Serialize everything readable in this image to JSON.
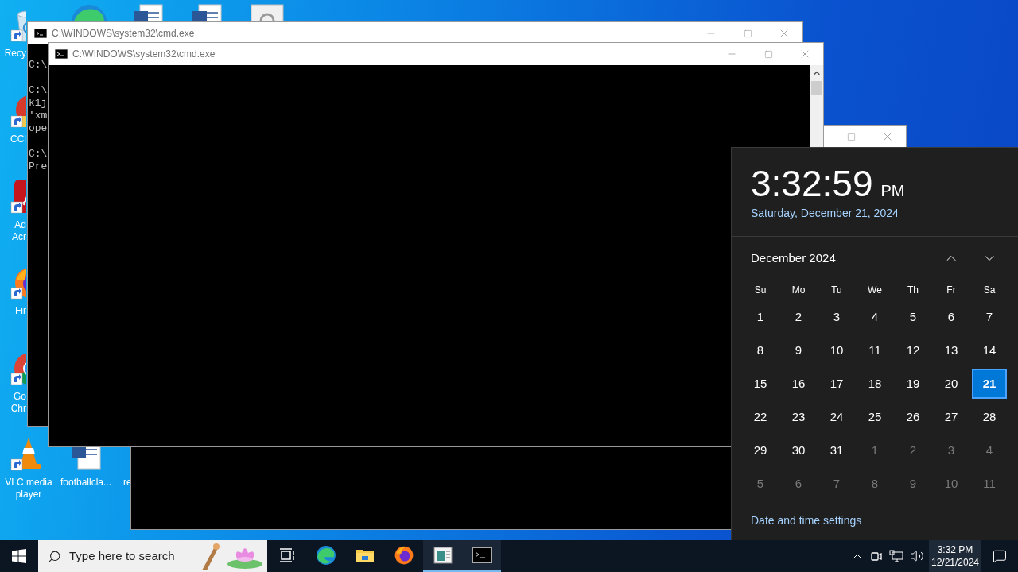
{
  "desktop": {
    "top_icons": [
      {
        "kind": "edge"
      },
      {
        "kind": "word"
      },
      {
        "kind": "word"
      },
      {
        "kind": "settings"
      }
    ],
    "icons": [
      {
        "kind": "recycle",
        "lines": [
          "Recy"
        ]
      },
      {
        "kind": "ccleaner",
        "lines": [
          "CCl"
        ]
      },
      {
        "kind": "acrobat",
        "lines": [
          "Ad",
          "Acr"
        ]
      },
      {
        "kind": "firefox",
        "lines": [
          "Fir"
        ]
      },
      {
        "kind": "chrome",
        "lines": [
          "Go",
          "Chr"
        ]
      },
      {
        "kind": "vlc",
        "lines": [
          "VLC media",
          "player"
        ]
      },
      {
        "kind": "word",
        "lines": [
          "footballcla..."
        ]
      },
      {
        "kind": "none",
        "lines": [
          "re"
        ]
      }
    ]
  },
  "windows": [
    {
      "title": "C:\\WINDOWS\\system32\\cmd.exe",
      "console_blocks": [
        [
          "C:\\"
        ],
        [
          "C:\\",
          "k1j",
          "'xm",
          "ope"
        ],
        [
          "C:\\",
          "Pre"
        ]
      ]
    },
    {
      "title": "C:\\WINDOWS\\system32\\cmd.exe"
    }
  ],
  "clock_flyout": {
    "time": "3:32:59",
    "ampm": "PM",
    "date": "Saturday, December 21, 2024",
    "month": "December 2024",
    "weekdays": [
      "Su",
      "Mo",
      "Tu",
      "We",
      "Th",
      "Fr",
      "Sa"
    ],
    "weeks": [
      [
        {
          "day": "1",
          "in_month": true,
          "selected": false
        },
        {
          "day": "2",
          "in_month": true,
          "selected": false
        },
        {
          "day": "3",
          "in_month": true,
          "selected": false
        },
        {
          "day": "4",
          "in_month": true,
          "selected": false
        },
        {
          "day": "5",
          "in_month": true,
          "selected": false
        },
        {
          "day": "6",
          "in_month": true,
          "selected": false
        },
        {
          "day": "7",
          "in_month": true,
          "selected": false
        }
      ],
      [
        {
          "day": "8",
          "in_month": true,
          "selected": false
        },
        {
          "day": "9",
          "in_month": true,
          "selected": false
        },
        {
          "day": "10",
          "in_month": true,
          "selected": false
        },
        {
          "day": "11",
          "in_month": true,
          "selected": false
        },
        {
          "day": "12",
          "in_month": true,
          "selected": false
        },
        {
          "day": "13",
          "in_month": true,
          "selected": false
        },
        {
          "day": "14",
          "in_month": true,
          "selected": false
        }
      ],
      [
        {
          "day": "15",
          "in_month": true,
          "selected": false
        },
        {
          "day": "16",
          "in_month": true,
          "selected": false
        },
        {
          "day": "17",
          "in_month": true,
          "selected": false
        },
        {
          "day": "18",
          "in_month": true,
          "selected": false
        },
        {
          "day": "19",
          "in_month": true,
          "selected": false
        },
        {
          "day": "20",
          "in_month": true,
          "selected": false
        },
        {
          "day": "21",
          "in_month": true,
          "selected": true
        }
      ],
      [
        {
          "day": "22",
          "in_month": true,
          "selected": false
        },
        {
          "day": "23",
          "in_month": true,
          "selected": false
        },
        {
          "day": "24",
          "in_month": true,
          "selected": false
        },
        {
          "day": "25",
          "in_month": true,
          "selected": false
        },
        {
          "day": "26",
          "in_month": true,
          "selected": false
        },
        {
          "day": "27",
          "in_month": true,
          "selected": false
        },
        {
          "day": "28",
          "in_month": true,
          "selected": false
        }
      ],
      [
        {
          "day": "29",
          "in_month": true,
          "selected": false
        },
        {
          "day": "30",
          "in_month": true,
          "selected": false
        },
        {
          "day": "31",
          "in_month": true,
          "selected": false
        },
        {
          "day": "1",
          "in_month": false,
          "selected": false
        },
        {
          "day": "2",
          "in_month": false,
          "selected": false
        },
        {
          "day": "3",
          "in_month": false,
          "selected": false
        },
        {
          "day": "4",
          "in_month": false,
          "selected": false
        }
      ],
      [
        {
          "day": "5",
          "in_month": false,
          "selected": false
        },
        {
          "day": "6",
          "in_month": false,
          "selected": false
        },
        {
          "day": "7",
          "in_month": false,
          "selected": false
        },
        {
          "day": "8",
          "in_month": false,
          "selected": false
        },
        {
          "day": "9",
          "in_month": false,
          "selected": false
        },
        {
          "day": "10",
          "in_month": false,
          "selected": false
        },
        {
          "day": "11",
          "in_month": false,
          "selected": false
        }
      ]
    ],
    "settings_link": "Date and time settings"
  },
  "taskbar": {
    "search_placeholder": "Type here to search",
    "apps": [
      {
        "kind": "taskview",
        "running": false
      },
      {
        "kind": "edge",
        "running": false
      },
      {
        "kind": "explorer",
        "running": false
      },
      {
        "kind": "firefox",
        "running": false
      },
      {
        "kind": "doc",
        "running": true
      },
      {
        "kind": "cmd",
        "running": true
      }
    ],
    "tray_time": "3:32 PM",
    "tray_date": "12/21/2024"
  }
}
